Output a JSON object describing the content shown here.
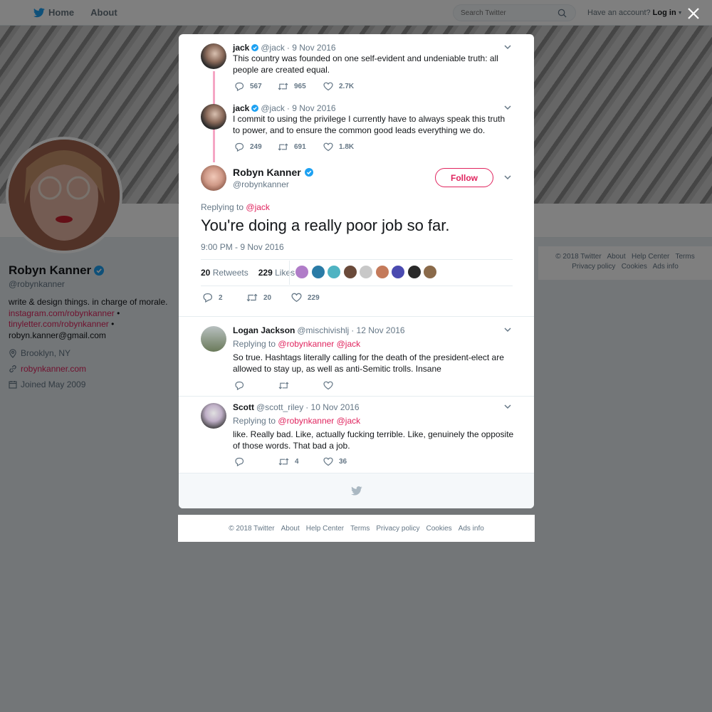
{
  "nav": {
    "home_label": "Home",
    "about_label": "About",
    "search_placeholder": "Search Twitter",
    "account_question": "Have an account?",
    "login_label": "Log in"
  },
  "profile": {
    "name": "Robyn Kanner",
    "handle": "@robynkanner",
    "bio": "write & design things. in charge of morale.",
    "link1": "instagram.com/robynkanner",
    "link2": "tinyletter.com/robynkanner",
    "bullet": "•",
    "email": "robyn.kanner@gmail.com",
    "location": "Brooklyn, NY",
    "website": "robynkanner.com",
    "joined": "Joined May 2009"
  },
  "side_footer": {
    "items_row1": [
      "© 2018 Twitter",
      "About",
      "Help Center",
      "Terms"
    ],
    "items_row2": [
      "Privacy policy",
      "Cookies",
      "Ads info"
    ]
  },
  "thread": [
    {
      "name": "jack",
      "handle": "@jack",
      "date": "· 9 Nov 2016",
      "text": "This country was founded on one self-evident and undeniable truth: all people are created equal.",
      "replies": "567",
      "retweets": "965",
      "likes": "2.7K"
    },
    {
      "name": "jack",
      "handle": "@jack",
      "date": "· 9 Nov 2016",
      "text": "I commit to using the privilege I currently have to always speak this truth to power, and to ensure the common good leads everything we do.",
      "replies": "249",
      "retweets": "691",
      "likes": "1.8K"
    }
  ],
  "main_tweet": {
    "name": "Robyn Kanner",
    "handle": "@robynkanner",
    "follow_label": "Follow",
    "replying_to_label": "Replying to",
    "replying_to_handle": "@jack",
    "text": "You're doing a really poor job so far.",
    "timestamp": "9:00 PM - 9 Nov 2016",
    "retweets_count": "20",
    "retweets_label": "Retweets",
    "likes_count": "229",
    "likes_label": "Likes",
    "replies": "2",
    "retweets": "20",
    "likes": "229"
  },
  "replies": [
    {
      "name": "Logan Jackson",
      "handle": "@mischivishlj",
      "date": "· 12 Nov 2016",
      "replying_to_label": "Replying to",
      "replying_to_1": "@robynkanner",
      "replying_to_2": "@jack",
      "text": "So true. Hashtags literally calling for the death of the president-elect are allowed to stay up, as well as anti-Semitic trolls. Insane",
      "replies": "",
      "retweets": "",
      "likes": ""
    },
    {
      "name": "Scott",
      "handle": "@scott_riley",
      "date": "· 10 Nov 2016",
      "replying_to_label": "Replying to",
      "replying_to_1": "@robynkanner",
      "replying_to_2": "@jack",
      "text": "like. Really bad. Like, actually fucking terrible. Like, genuinely the opposite of those words. That bad a job.",
      "replies": "",
      "retweets": "4",
      "likes": "36"
    }
  ],
  "modal_footer": {
    "items": [
      "© 2018 Twitter",
      "About",
      "Help Center",
      "Terms",
      "Privacy policy",
      "Cookies",
      "Ads info"
    ]
  },
  "colors": {
    "accent": "#e0245e",
    "verified": "#1da1f2",
    "thread_line": "#f5a6c4"
  }
}
